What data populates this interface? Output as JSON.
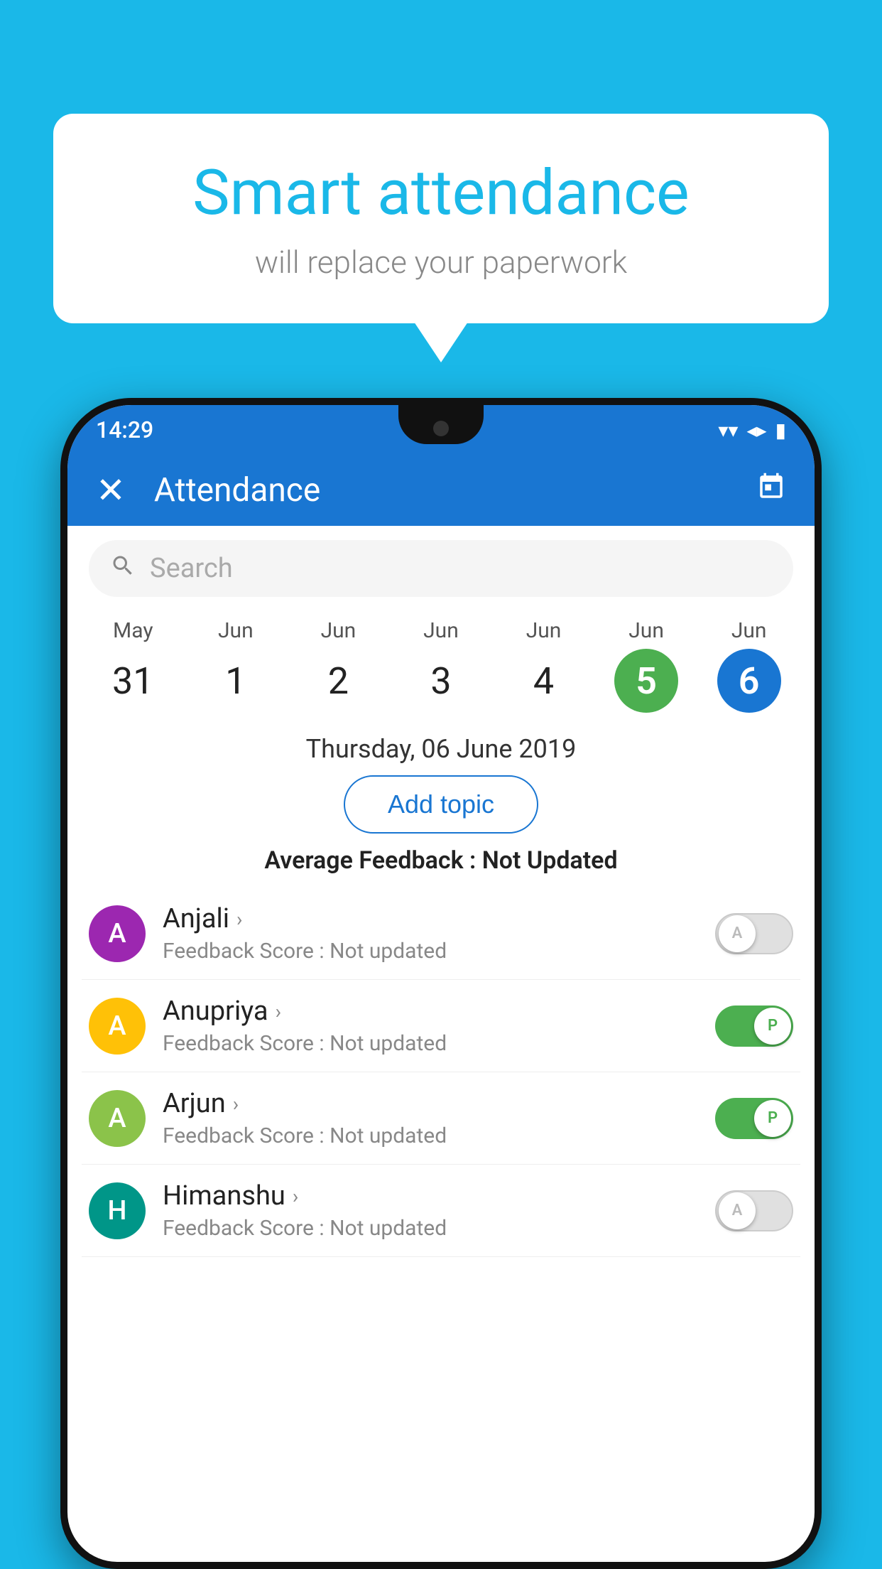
{
  "background_color": "#1ab8e8",
  "bubble": {
    "title": "Smart attendance",
    "subtitle": "will replace your paperwork"
  },
  "status_bar": {
    "time": "14:29",
    "wifi": "▲",
    "signal": "▲",
    "battery": "▮"
  },
  "header": {
    "title": "Attendance",
    "close_label": "✕",
    "calendar_icon": "📅"
  },
  "search": {
    "placeholder": "Search"
  },
  "calendar": {
    "days": [
      {
        "month": "May",
        "num": "31",
        "style": "normal"
      },
      {
        "month": "Jun",
        "num": "1",
        "style": "normal"
      },
      {
        "month": "Jun",
        "num": "2",
        "style": "normal"
      },
      {
        "month": "Jun",
        "num": "3",
        "style": "normal"
      },
      {
        "month": "Jun",
        "num": "4",
        "style": "normal"
      },
      {
        "month": "Jun",
        "num": "5",
        "style": "green"
      },
      {
        "month": "Jun",
        "num": "6",
        "style": "blue"
      }
    ],
    "selected_date": "Thursday, 06 June 2019"
  },
  "add_topic_label": "Add topic",
  "avg_feedback": {
    "label": "Average Feedback : ",
    "value": "Not Updated"
  },
  "students": [
    {
      "name": "Anjali",
      "avatar_letter": "A",
      "avatar_color": "purple",
      "feedback": "Feedback Score : Not updated",
      "toggle": "off",
      "toggle_label": "A"
    },
    {
      "name": "Anupriya",
      "avatar_letter": "A",
      "avatar_color": "yellow",
      "feedback": "Feedback Score : Not updated",
      "toggle": "on",
      "toggle_label": "P"
    },
    {
      "name": "Arjun",
      "avatar_letter": "A",
      "avatar_color": "light-green",
      "feedback": "Feedback Score : Not updated",
      "toggle": "on",
      "toggle_label": "P"
    },
    {
      "name": "Himanshu",
      "avatar_letter": "H",
      "avatar_color": "teal",
      "feedback": "Feedback Score : Not updated",
      "toggle": "off",
      "toggle_label": "A"
    }
  ]
}
